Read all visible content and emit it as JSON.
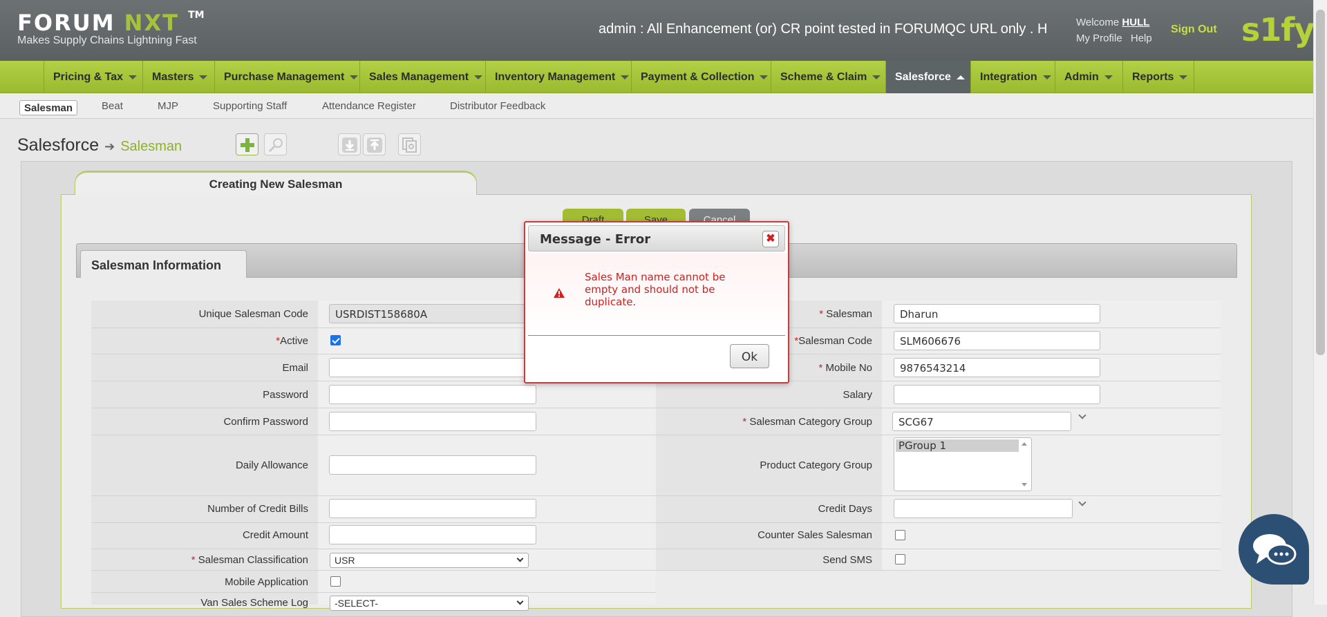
{
  "header": {
    "logo_main": "FORUM",
    "logo_nxt": "NXT",
    "logo_tm": "TM",
    "tagline": "Makes Supply Chains Lightning Fast",
    "marquee": "admin : All Enhancement (or) CR point tested in FORUMQC URL only . H",
    "welcome_prefix": "Welcome",
    "welcome_user": "HULL",
    "my_profile": "My Profile",
    "help": "Help",
    "sign_out": "Sign Out",
    "brand": "s1fy"
  },
  "nav": {
    "items": [
      {
        "label": "Pricing & Tax"
      },
      {
        "label": "Masters"
      },
      {
        "label": "Purchase Management"
      },
      {
        "label": "Sales Management"
      },
      {
        "label": "Inventory Management"
      },
      {
        "label": "Payment & Collection"
      },
      {
        "label": "Scheme & Claim"
      },
      {
        "label": "Salesforce"
      },
      {
        "label": "Integration"
      },
      {
        "label": "Admin"
      },
      {
        "label": "Reports"
      }
    ],
    "active": "Salesforce"
  },
  "subnav": {
    "items": [
      "Salesman",
      "Beat",
      "MJP",
      "Supporting Staff",
      "Attendance Register",
      "Distributor Feedback"
    ]
  },
  "breadcrumb": {
    "root": "Salesforce",
    "current": "Salesman"
  },
  "form": {
    "tab_title": "Creating New Salesman",
    "buttons": {
      "draft": "Draft",
      "save": "Save",
      "cancel": "Cancel"
    },
    "section_tab": "Salesman Information",
    "left": {
      "unique_code_label": "Unique Salesman Code",
      "unique_code_value": "USRDIST158680A",
      "active_label": "Active",
      "active_checked": true,
      "email_label": "Email",
      "password_label": "Password",
      "confirm_password_label": "Confirm Password",
      "daily_allowance_label": "Daily Allowance",
      "credit_bills_label": "Number of Credit Bills",
      "credit_amount_label": "Credit Amount",
      "classification_label": "Salesman Classification",
      "classification_value": "USR",
      "mobile_app_label": "Mobile Application",
      "van_sales_label": "Van Sales Scheme Log",
      "van_sales_value": "-SELECT-"
    },
    "right": {
      "salesman_label": "Salesman",
      "salesman_value": "Dharun",
      "salesman_code_label": "Salesman Code",
      "salesman_code_value": "SLM606676",
      "mobile_label": "Mobile No",
      "mobile_value": "9876543214",
      "salary_label": "Salary",
      "category_group_label": "Salesman Category Group",
      "category_group_value": "SCG67",
      "product_category_label": "Product Category Group",
      "product_category_options": [
        "PGroup 1"
      ],
      "credit_days_label": "Credit Days",
      "counter_sales_label": "Counter Sales Salesman",
      "send_sms_label": "Send SMS"
    },
    "required_mark": "*"
  },
  "dialog": {
    "title": "Message - Error",
    "close": "✖",
    "message": "Sales Man name cannot be empty and should not be duplicate.",
    "ok": "Ok"
  },
  "colors": {
    "accent": "#a6c23a",
    "error": "#d02020",
    "header": "#5f6567"
  }
}
